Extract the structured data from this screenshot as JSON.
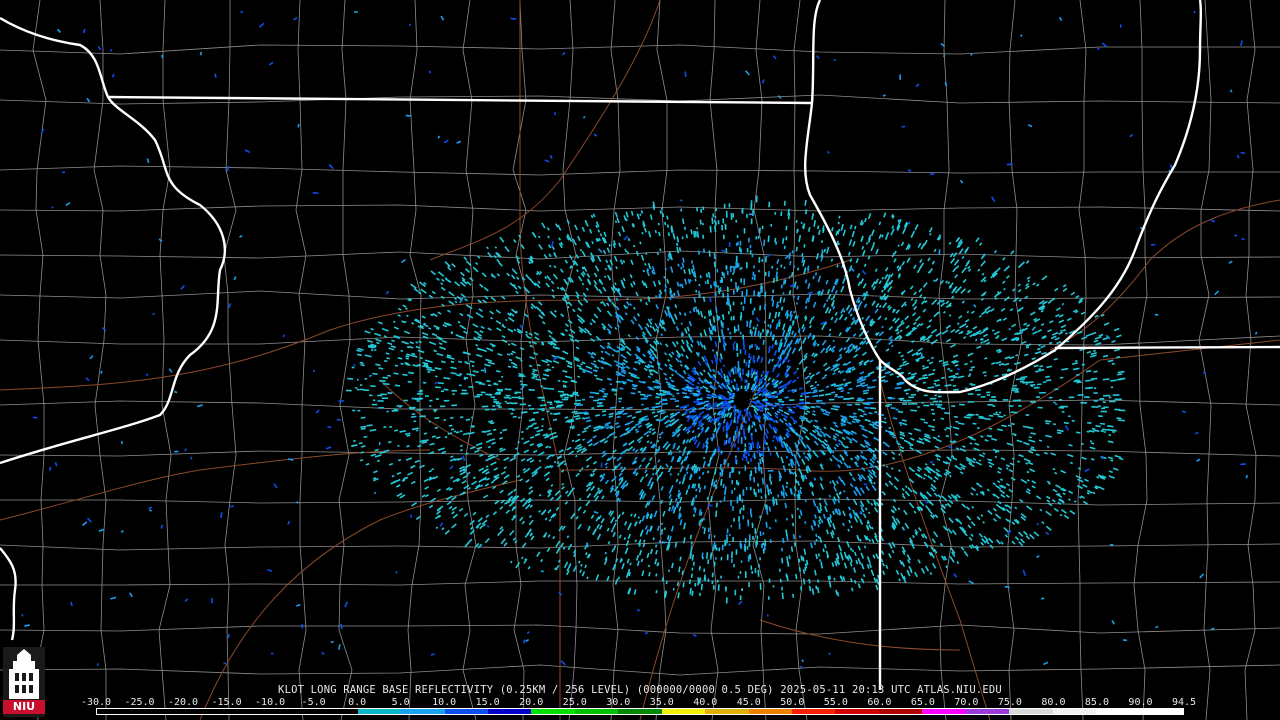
{
  "product": {
    "caption": "KLOT LONG RANGE BASE REFLECTIVITY (0.25KM / 256 LEVEL) (000000/0000 0.5 DEG) 2025-05-11 20:13 UTC  ATLAS.NIU.EDU"
  },
  "logo": {
    "text": "NIU",
    "icon": "niu-castle-logo",
    "color": "#c8102e"
  },
  "scale": {
    "labels": [
      "-30.0",
      "-25.0",
      "-20.0",
      "-15.0",
      "-10.0",
      "-5.0",
      "0.0",
      "5.0",
      "10.0",
      "15.0",
      "20.0",
      "25.0",
      "30.0",
      "35.0",
      "40.0",
      "45.0",
      "50.0",
      "55.0",
      "60.0",
      "65.0",
      "70.0",
      "75.0",
      "80.0",
      "85.0",
      "90.0",
      "94.5"
    ],
    "colors": [
      "#000000",
      "#000000",
      "#000000",
      "#000000",
      "#000000",
      "#000000",
      "#08b8c8",
      "#1aa0f0",
      "#0a50f0",
      "#0000c8",
      "#00e000",
      "#00c000",
      "#008800",
      "#f0f000",
      "#e0b000",
      "#f08000",
      "#ff2000",
      "#d00000",
      "#b00000",
      "#ff00ff",
      "#9a3ad8",
      "#d8d8d8",
      "#f0f0f0",
      "#ffffff",
      "#ffffff"
    ]
  },
  "map": {
    "radar_site": "KLOT",
    "colors": {
      "state_border": "#ffffff",
      "county_border": "#9a9a9a",
      "highway": "#8b4a2a",
      "echo_light": "#22c8d8",
      "echo_mid": "#1aa0f0",
      "echo_dark": "#0a50f0"
    }
  }
}
